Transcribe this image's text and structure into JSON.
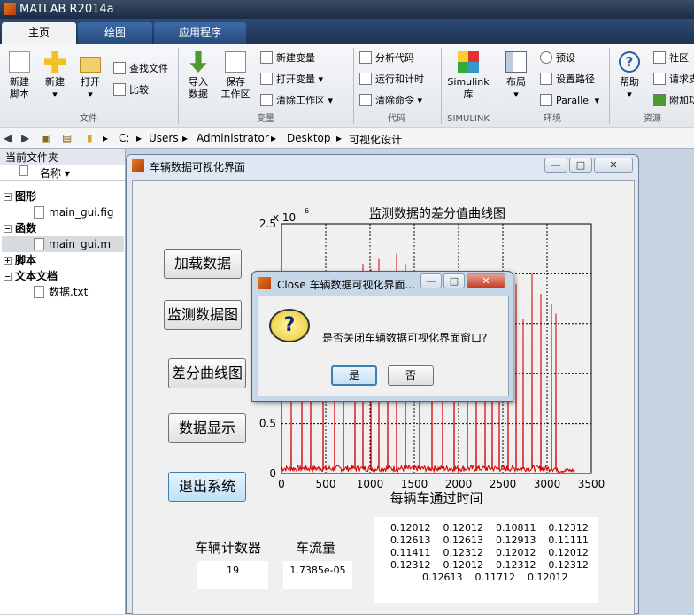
{
  "app": {
    "title": "MATLAB R2014a"
  },
  "tabs": [
    {
      "label": "主页"
    },
    {
      "label": "绘图"
    },
    {
      "label": "应用程序"
    }
  ],
  "ribbon": {
    "new_script": "新建\n脚本",
    "new": "新建",
    "open": "打开",
    "find_files": "查找文件",
    "compare": "比较",
    "import": "导入\n数据",
    "save_ws": "保存\n工作区",
    "new_var": "新建变量",
    "open_var": "打开变量",
    "clear_ws": "清除工作区",
    "analyze": "分析代码",
    "run_time": "运行和计时",
    "clear_cmd": "清除命令",
    "simulink": "Simulink\n库",
    "layout": "布局",
    "prefs": "预设",
    "set_path": "设置路径",
    "parallel": "Parallel",
    "help": "帮助",
    "community": "社区",
    "request": "请求支",
    "addons": "附加功",
    "groups": {
      "file": "文件",
      "var": "变量",
      "code": "代码",
      "simulink": "SIMULINK",
      "env": "环境",
      "res": "资源"
    }
  },
  "path": [
    "C:",
    "Users",
    "Administrator",
    "Desktop",
    "可视化设计"
  ],
  "left": {
    "title": "当前文件夹",
    "col": "名称",
    "tree": [
      {
        "label": "图形",
        "type": "group"
      },
      {
        "label": "main_gui.fig",
        "type": "file"
      },
      {
        "label": "函数",
        "type": "group"
      },
      {
        "label": "main_gui.m",
        "type": "file"
      },
      {
        "label": "脚本",
        "type": "group"
      },
      {
        "label": "文本文档",
        "type": "group"
      },
      {
        "label": "数据.txt",
        "type": "file"
      }
    ]
  },
  "fig": {
    "title": "车辆数据可视化界面",
    "buttons": [
      "加载数据",
      "监测数据图",
      "差分曲线图",
      "数据显示",
      "退出系统"
    ],
    "counter_label": "车辆计数器",
    "counter_value": "19",
    "flow_label": "车流量",
    "flow_value": "1.7385e-05",
    "table_rows": [
      "0.12012    0.12012    0.10811    0.12312",
      "0.12613    0.12613    0.12913    0.11111",
      "0.11411    0.12312    0.12012    0.12012",
      "0.12312    0.12012    0.12312    0.12312",
      "0.12613    0.11712    0.12012"
    ]
  },
  "chart_data": {
    "type": "line",
    "title": "监测数据的差分值曲线图",
    "xlabel": "每辆车通过时间",
    "ylabel": "",
    "exponent_label": "x 10",
    "exponent": "6",
    "xlim": [
      0,
      3500
    ],
    "ylim": [
      0,
      2.5
    ],
    "xticks": [
      0,
      500,
      1000,
      1500,
      2000,
      2500,
      3000,
      3500
    ],
    "yticks": [
      0,
      0.5,
      1,
      1.5,
      2,
      2.5
    ],
    "xtick_labels": [
      "0",
      "500",
      "1000",
      "1500",
      "2000",
      "2500",
      "3000",
      "3500"
    ],
    "ytick_labels": [
      "0",
      "0.5",
      "",
      "",
      "",
      "2.5"
    ],
    "grid": true,
    "color": "#d40000",
    "peaks": [
      {
        "x": 110,
        "y": 1.2
      },
      {
        "x": 230,
        "y": 1.7
      },
      {
        "x": 330,
        "y": 1.6
      },
      {
        "x": 470,
        "y": 1.8
      },
      {
        "x": 600,
        "y": 1.9
      },
      {
        "x": 700,
        "y": 1.85
      },
      {
        "x": 830,
        "y": 2.0
      },
      {
        "x": 920,
        "y": 2.1
      },
      {
        "x": 1010,
        "y": 2.05
      },
      {
        "x": 1100,
        "y": 2.15
      },
      {
        "x": 1200,
        "y": 2.0
      },
      {
        "x": 1300,
        "y": 2.2
      },
      {
        "x": 1400,
        "y": 2.1
      },
      {
        "x": 1560,
        "y": 2.0
      },
      {
        "x": 1700,
        "y": 1.9
      },
      {
        "x": 1820,
        "y": 2.0
      },
      {
        "x": 1950,
        "y": 1.95
      },
      {
        "x": 2100,
        "y": 1.8
      },
      {
        "x": 2200,
        "y": 1.5
      },
      {
        "x": 2300,
        "y": 1.2
      },
      {
        "x": 2380,
        "y": 1.6
      },
      {
        "x": 2460,
        "y": 1.0
      },
      {
        "x": 2560,
        "y": 1.3
      },
      {
        "x": 2650,
        "y": 1.9
      },
      {
        "x": 2730,
        "y": 1.55
      },
      {
        "x": 2830,
        "y": 2.0
      },
      {
        "x": 2930,
        "y": 1.8
      },
      {
        "x": 3050,
        "y": 1.7
      },
      {
        "x": 3100,
        "y": 1.6
      }
    ],
    "xmax": 3320
  },
  "dialog": {
    "title": "Close 车辆数据可视化界面...",
    "message": "是否关闭车辆数据可视化界面窗口?",
    "yes": "是",
    "no": "否"
  }
}
